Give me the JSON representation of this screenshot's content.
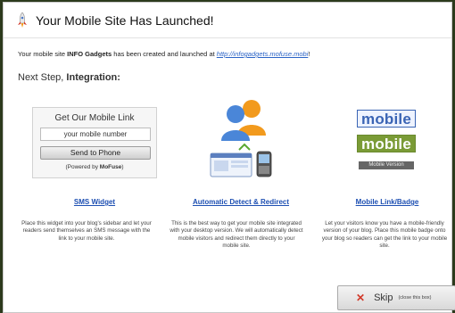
{
  "header": {
    "title": "Your Mobile Site Has Launched!"
  },
  "description": {
    "prefix": "Your mobile site ",
    "site_name": "INFO Gadgets",
    "middle": " has been created and launched at ",
    "url": "http://infogadgets.mofuse.mobi",
    "suffix": "!"
  },
  "next_step": {
    "prefix": "Next Step, ",
    "emphasis": "Integration:"
  },
  "sms_widget": {
    "box_title": "Get Our Mobile Link",
    "input_value": "your mobile number",
    "button_label": "Send to Phone",
    "powered_prefix": "(Powered by ",
    "powered_brand": "MoFuse",
    "powered_suffix": ")",
    "title": "SMS Widget",
    "text": "Place this widget into your blog's sidebar and let your readers send themselves an SMS message with the link to your mobile site."
  },
  "auto_detect": {
    "title": "Automatic Detect & Redirect",
    "text": "This is the best way to get your mobile site integrated with your desktop version. We will automatically detect mobile visitors and redirect them directly to your mobile site."
  },
  "mobile_badge": {
    "badge1": "mobile",
    "badge2": "mobile",
    "badge3": "Mobile Version",
    "title": "Mobile Link/Badge",
    "text": "Let your visitors know you have a mobile-friendly version of your blog. Place this mobile badge onto your blog so readers can get the link to your mobile site."
  },
  "skip": {
    "icon": "close-icon",
    "label": "Skip",
    "sub": "(close this box)"
  }
}
